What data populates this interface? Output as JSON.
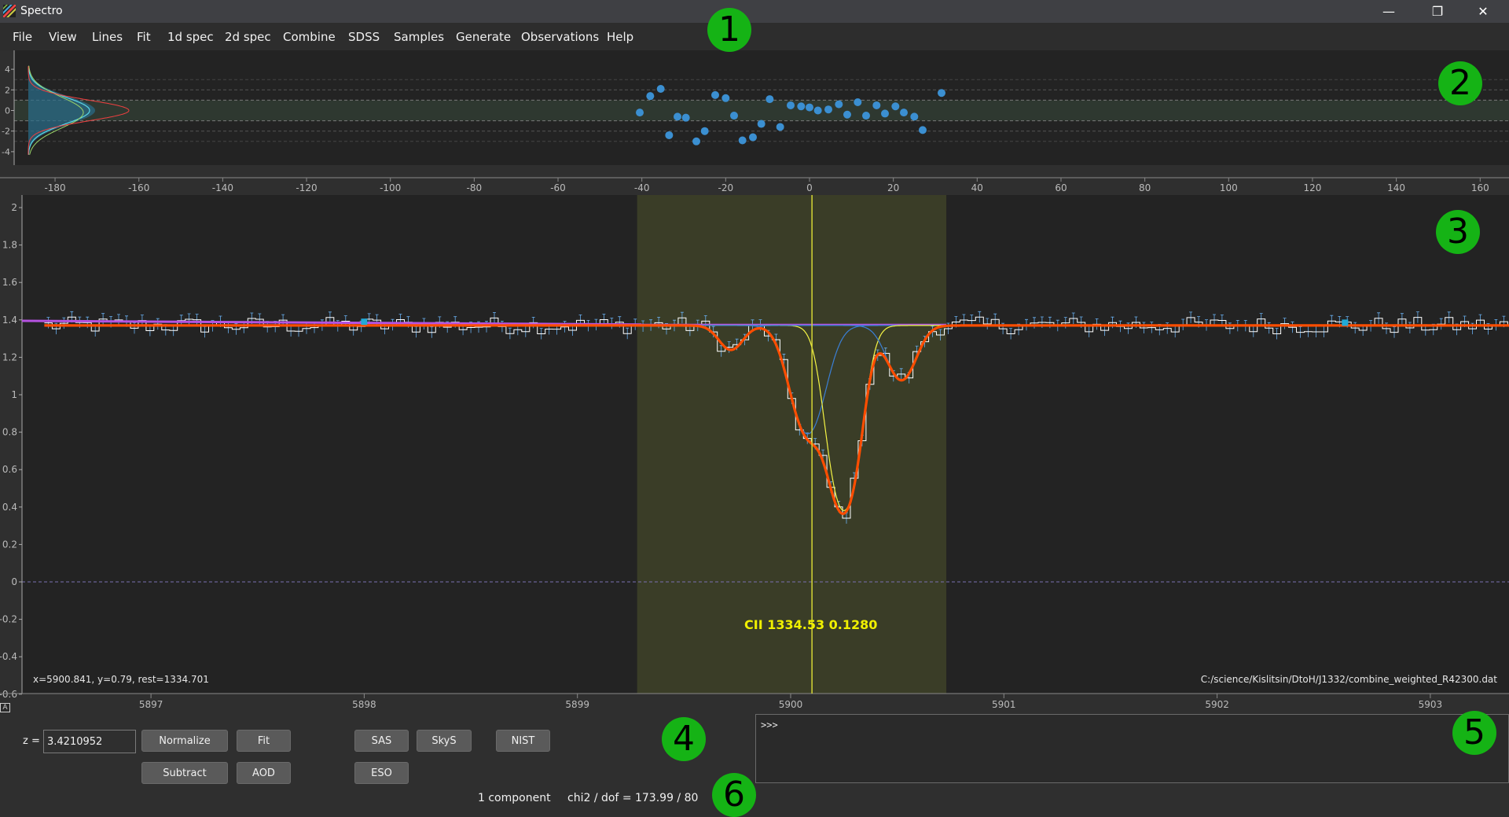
{
  "app": {
    "title": "Spectro",
    "window_controls": {
      "minimize": "—",
      "restore": "❐",
      "close": "✕"
    }
  },
  "menu": [
    "File",
    "View",
    "Lines",
    "Fit",
    "1d spec",
    "2d spec",
    "Combine",
    "SDSS",
    "Samples",
    "Generate",
    "Observations",
    "Help"
  ],
  "annotations": [
    "1",
    "2",
    "3",
    "4",
    "5",
    "6"
  ],
  "residuals_panel": {
    "y_ticks": [
      "4",
      "2",
      "0",
      "-2",
      "-4"
    ],
    "x_ticks": [
      "-180",
      "-160",
      "-140",
      "-120",
      "-100",
      "-80",
      "-60",
      "-40",
      "-20",
      "0",
      "20",
      "40",
      "60",
      "80",
      "100",
      "120",
      "140",
      "160"
    ],
    "points": [
      [
        -40.5,
        -0.2
      ],
      [
        -38,
        1.4
      ],
      [
        -35.5,
        2.1
      ],
      [
        -33.5,
        -2.4
      ],
      [
        -31.5,
        -0.6
      ],
      [
        -29.5,
        -0.7
      ],
      [
        -27,
        -3.0
      ],
      [
        -25,
        -2.0
      ],
      [
        -22.5,
        1.5
      ],
      [
        -20,
        1.2
      ],
      [
        -18,
        -0.5
      ],
      [
        -16,
        -2.9
      ],
      [
        -13.5,
        -2.6
      ],
      [
        -11.5,
        -1.3
      ],
      [
        -9.5,
        1.1
      ],
      [
        -7,
        -1.6
      ],
      [
        -4.5,
        0.5
      ],
      [
        -2,
        0.4
      ],
      [
        0,
        0.3
      ],
      [
        2,
        0.0
      ],
      [
        4.5,
        0.1
      ],
      [
        7,
        0.6
      ],
      [
        9,
        -0.4
      ],
      [
        11.5,
        0.8
      ],
      [
        13.5,
        -0.5
      ],
      [
        16,
        0.5
      ],
      [
        18,
        -0.3
      ],
      [
        20.5,
        0.4
      ],
      [
        22.5,
        -0.2
      ],
      [
        25,
        -0.6
      ],
      [
        27,
        -1.9
      ],
      [
        31.5,
        1.7
      ]
    ]
  },
  "spectrum_panel": {
    "y_ticks": [
      "2",
      "1.8",
      "1.6",
      "1.4",
      "1.2",
      "1",
      "0.8",
      "0.6",
      "0.4",
      "0.2",
      "0",
      "-0.2",
      "-0.4",
      "-0.6"
    ],
    "x_ticks": [
      "5897",
      "5898",
      "5899",
      "5900",
      "5901",
      "5902",
      "5903"
    ],
    "line_label": "CII 1334.53 0.1280",
    "cursor_readout": "x=5900.841, y=0.79, rest=1334.701",
    "file_path": "C:/science/Kislitsin/DtoH/J1332/combine_weighted_R42300.dat",
    "continuum": 1.37,
    "components": [
      {
        "center": 5899.72,
        "depth": 0.1,
        "sigma": 0.055
      },
      {
        "center": 5900.08,
        "depth": 0.55,
        "sigma": 0.075
      },
      {
        "center": 5900.25,
        "depth": 1.28,
        "sigma": 0.065
      },
      {
        "center": 5900.52,
        "depth": 0.24,
        "sigma": 0.065
      }
    ],
    "colors": {
      "data": "#ffffff",
      "fit": "#ff4d00",
      "component_yellow": "#f5f545",
      "component_blue": "#3a7fd5",
      "continuum": "#b552e0",
      "fit_region": "#3a3d27",
      "line_marker": "#d6d635",
      "errors": "#6ab0f0"
    }
  },
  "controls": {
    "z_label": "z =",
    "z_value": "3.4210952",
    "buttons": {
      "normalize": "Normalize",
      "fit": "Fit",
      "sas": "SAS",
      "skys": "SkyS",
      "nist": "NIST",
      "subtract": "Subtract",
      "aod": "AOD",
      "eso": "ESO"
    },
    "console_prompt": ">>>",
    "reset_label": "A",
    "status": {
      "components": "1 component",
      "chi2": "chi2 / dof = 173.99 / 80"
    }
  }
}
